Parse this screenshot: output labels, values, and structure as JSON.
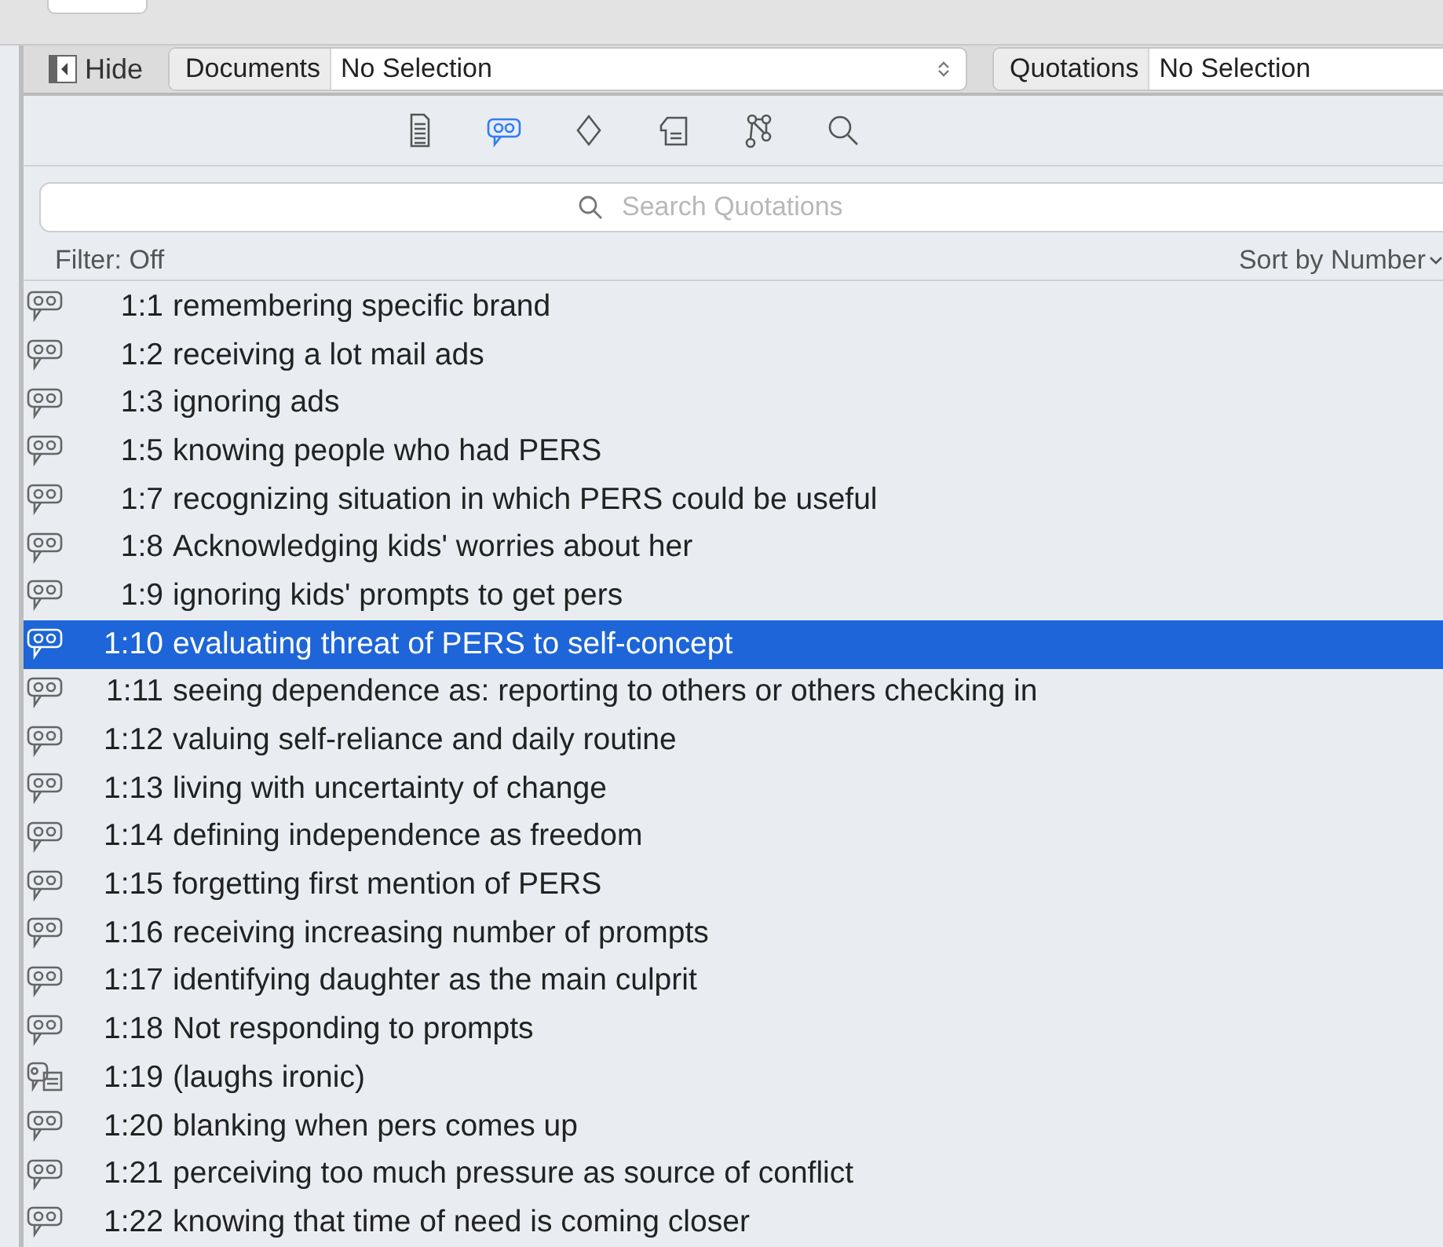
{
  "toolbar": {
    "hide_label": "Hide",
    "documents": {
      "label": "Documents",
      "value": "No Selection"
    },
    "quotations": {
      "label": "Quotations",
      "value": "No Selection"
    }
  },
  "tabs": [
    {
      "kind": "document",
      "selected": false
    },
    {
      "kind": "quotation",
      "selected": true
    },
    {
      "kind": "code",
      "selected": false
    },
    {
      "kind": "memo",
      "selected": false
    },
    {
      "kind": "network",
      "selected": false
    },
    {
      "kind": "search",
      "selected": false
    }
  ],
  "search": {
    "placeholder": "Search Quotations"
  },
  "filter": "Filter: Off",
  "sort": "Sort by Number",
  "quotations": [
    {
      "kind": "quote",
      "number": "1:1",
      "text": "remembering specific brand",
      "selected": false
    },
    {
      "kind": "quote",
      "number": "1:2",
      "text": "receiving a lot mail ads",
      "selected": false
    },
    {
      "kind": "quote",
      "number": "1:3",
      "text": "ignoring ads",
      "selected": false
    },
    {
      "kind": "quote",
      "number": "1:5",
      "text": "knowing people who had PERS",
      "selected": false
    },
    {
      "kind": "quote",
      "number": "1:7",
      "text": "recognizing situation in which PERS could be useful",
      "selected": false
    },
    {
      "kind": "quote",
      "number": "1:8",
      "text": "Acknowledging kids' worries about her",
      "selected": false
    },
    {
      "kind": "quote",
      "number": "1:9",
      "text": "ignoring kids' prompts to get pers",
      "selected": false
    },
    {
      "kind": "quote",
      "number": "1:10",
      "text": "evaluating threat of PERS to self-concept",
      "selected": true
    },
    {
      "kind": "quote",
      "number": "1:11",
      "text": "seeing dependence as: reporting to others or others checking in",
      "selected": false
    },
    {
      "kind": "quote",
      "number": "1:12",
      "text": "valuing self-reliance and daily routine",
      "selected": false
    },
    {
      "kind": "quote",
      "number": "1:13",
      "text": "living with uncertainty of change",
      "selected": false
    },
    {
      "kind": "quote",
      "number": "1:14",
      "text": "defining independence as freedom",
      "selected": false
    },
    {
      "kind": "quote",
      "number": "1:15",
      "text": "forgetting first mention of PERS",
      "selected": false
    },
    {
      "kind": "quote",
      "number": "1:16",
      "text": "receiving increasing number of prompts",
      "selected": false
    },
    {
      "kind": "quote",
      "number": "1:17",
      "text": "identifying daughter as the main culprit",
      "selected": false
    },
    {
      "kind": "quote",
      "number": "1:18",
      "text": "Not responding to prompts",
      "selected": false
    },
    {
      "kind": "commented",
      "number": "1:19",
      "text": "(laughs ironic)",
      "selected": false
    },
    {
      "kind": "quote",
      "number": "1:20",
      "text": "blanking when pers comes up",
      "selected": false
    },
    {
      "kind": "quote",
      "number": "1:21",
      "text": "perceiving too much pressure as source of conflict",
      "selected": false
    },
    {
      "kind": "quote",
      "number": "1:22",
      "text": "knowing that time of need is coming closer",
      "selected": false
    }
  ]
}
